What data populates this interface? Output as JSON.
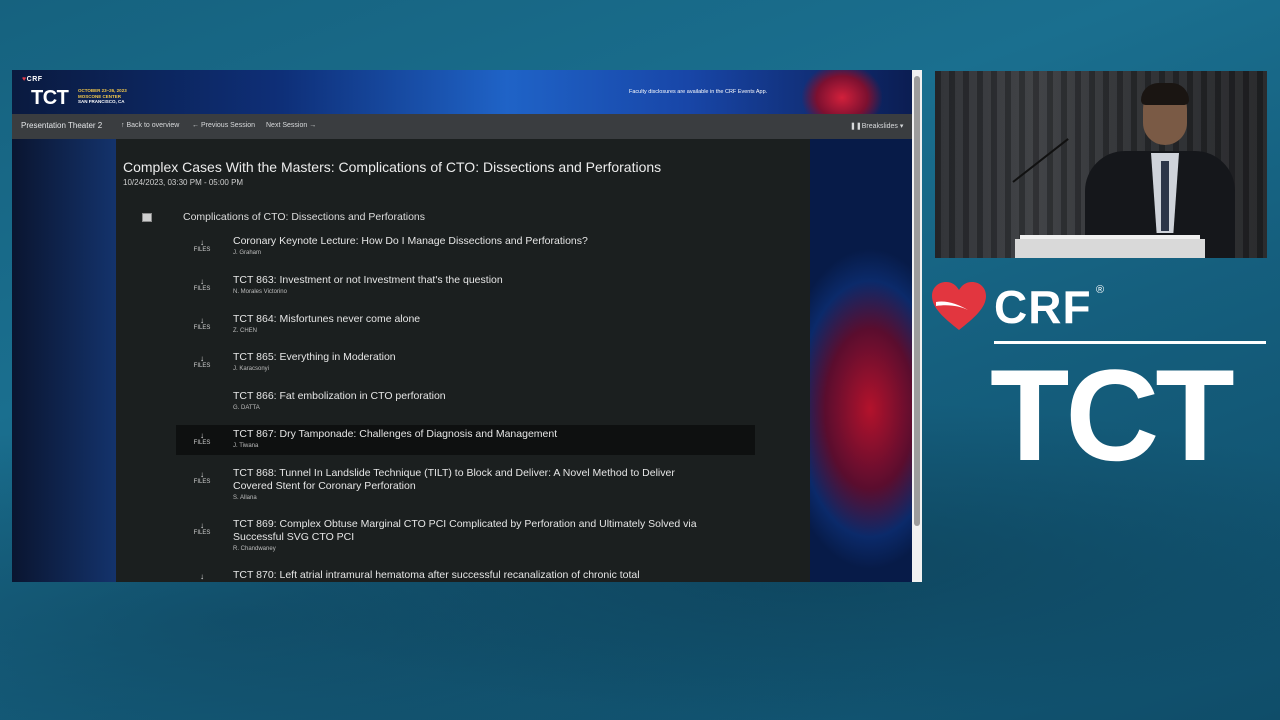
{
  "banner": {
    "logo_crf": "CRF",
    "logo_tct": "TCT",
    "event_dates": "OCTOBER 23–26, 2023",
    "event_venue": "MOSCONE CENTER",
    "event_city": "SAN FRANCISCO, CA",
    "disclosure": "Faculty disclosures are available in the CRF Events App."
  },
  "nav": {
    "title": "Presentation Theater 2",
    "back": "Back to overview",
    "previous": "Previous Session",
    "next": "Next Session",
    "breakslides": "Breakslides"
  },
  "session": {
    "title": "Complex Cases With the Masters: Complications of CTO: Dissections and Perforations",
    "date": "10/24/2023, 03:30 PM - 05:00 PM",
    "group_label": "Complications of CTO: Dissections and Perforations"
  },
  "files_label": "FILES",
  "presentations": [
    {
      "title": "Coronary Keynote Lecture: How Do I Manage Dissections and Perforations?",
      "author": "J. Graham",
      "has_files": true
    },
    {
      "title": "TCT 863: Investment or not Investment that's the question",
      "author": "N. Morales Victorino",
      "has_files": true
    },
    {
      "title": "TCT 864: Misfortunes never come alone",
      "author": "Z. CHEN",
      "has_files": true
    },
    {
      "title": "TCT 865: Everything in Moderation",
      "author": "J. Karacsonyi",
      "has_files": true
    },
    {
      "title": "TCT 866: Fat embolization in CTO perforation",
      "author": "G. DATTA",
      "has_files": false
    },
    {
      "title": "TCT 867: Dry Tamponade: Challenges of Diagnosis and Management",
      "author": "J. Tiwana",
      "has_files": true
    },
    {
      "title": "TCT 868: Tunnel In Landslide Technique (TILT) to Block and Deliver: A Novel Method to Deliver Covered Stent for Coronary Perforation",
      "author": "S. Allana",
      "has_files": true
    },
    {
      "title": "TCT 869: Complex Obtuse Marginal CTO PCI Complicated by Perforation and Ultimately Solved via Successful SVG CTO PCI",
      "author": "R. Chandwaney",
      "has_files": true
    },
    {
      "title": "TCT 870: Left atrial intramural hematoma after successful recanalization of chronic total",
      "author": "",
      "has_files": true
    }
  ],
  "brand": {
    "crf": "CRF",
    "reg": "®",
    "tct": "TCT"
  },
  "colors": {
    "background": "#1a6f8f",
    "panel": "#1b1f1f",
    "navbar": "#3a3d40",
    "brand_red": "#e23b4a",
    "accent_gold": "#f3c84a"
  }
}
